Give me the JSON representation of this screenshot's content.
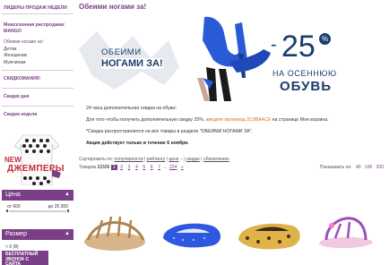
{
  "sidebar": {
    "header": "ЛИДЕРЫ ПРОДАЖ НЕДЕЛИ",
    "block1_title": "Межсезонная распродажа: MANGO",
    "categories": [
      "Обеими ногами за!",
      "Детям",
      "Женщинам",
      "Мужчинам"
    ],
    "skidkomania": "СКИДКОМАНИЯ!",
    "day_deals": "Скидки дня",
    "week_deals": "Скидки недели",
    "promo_new": "NEW",
    "promo_title": "ДЖЕМПЕРЫ",
    "price_label": "Цена",
    "price_from": "от 600",
    "price_to": "до 25 300",
    "size_label": "Размер",
    "size_value": "□ 0 (8)",
    "call_button": "БЕСПЛАТНЫЙ ЗВОНОК С САЙТА"
  },
  "main": {
    "title": "Обеими ногами за!",
    "banner": {
      "line1": "ОБЕИМИ",
      "line2": "НОГАМИ ЗА!",
      "minus": "-",
      "number": "25",
      "percent": "%",
      "line3": "НА ОСЕННЮЮ",
      "line4": "ОБУВЬ"
    },
    "info": {
      "p1": "24 часа дополнительная скидка на обувь!",
      "p2_before": "Для того чтобы получить дополнительную скидку 25%, ",
      "p2_code": "введите промокод 2С0BAACE",
      "p2_after": " на странице Моя корзина.",
      "p3": "*Скидка распространяется на все товары в разделе \"ОБЕИМИ НОГАМИ ЗА\".",
      "p4": "Акция действует только в течение 6 ноября."
    },
    "sort": {
      "label": "Сортировать по:",
      "popularity": "популярности",
      "rating": "рейтингу",
      "price": "цене",
      "discount": "скидке",
      "update": "обновлению"
    },
    "pager": {
      "goods_label": "Товаров",
      "goods_count": "22326",
      "pages": [
        "1",
        "2",
        "3",
        "4",
        "5",
        "6",
        "7",
        "...",
        "224",
        "»"
      ],
      "perpage_label": "Показывать по:",
      "perpage_options": [
        "40",
        "100",
        "200"
      ]
    }
  },
  "colors": {
    "brand": "#7a3f86",
    "navy": "#1a3d6e",
    "promo_code": "#e06a1a",
    "jumper_red": "#c62d3a"
  }
}
